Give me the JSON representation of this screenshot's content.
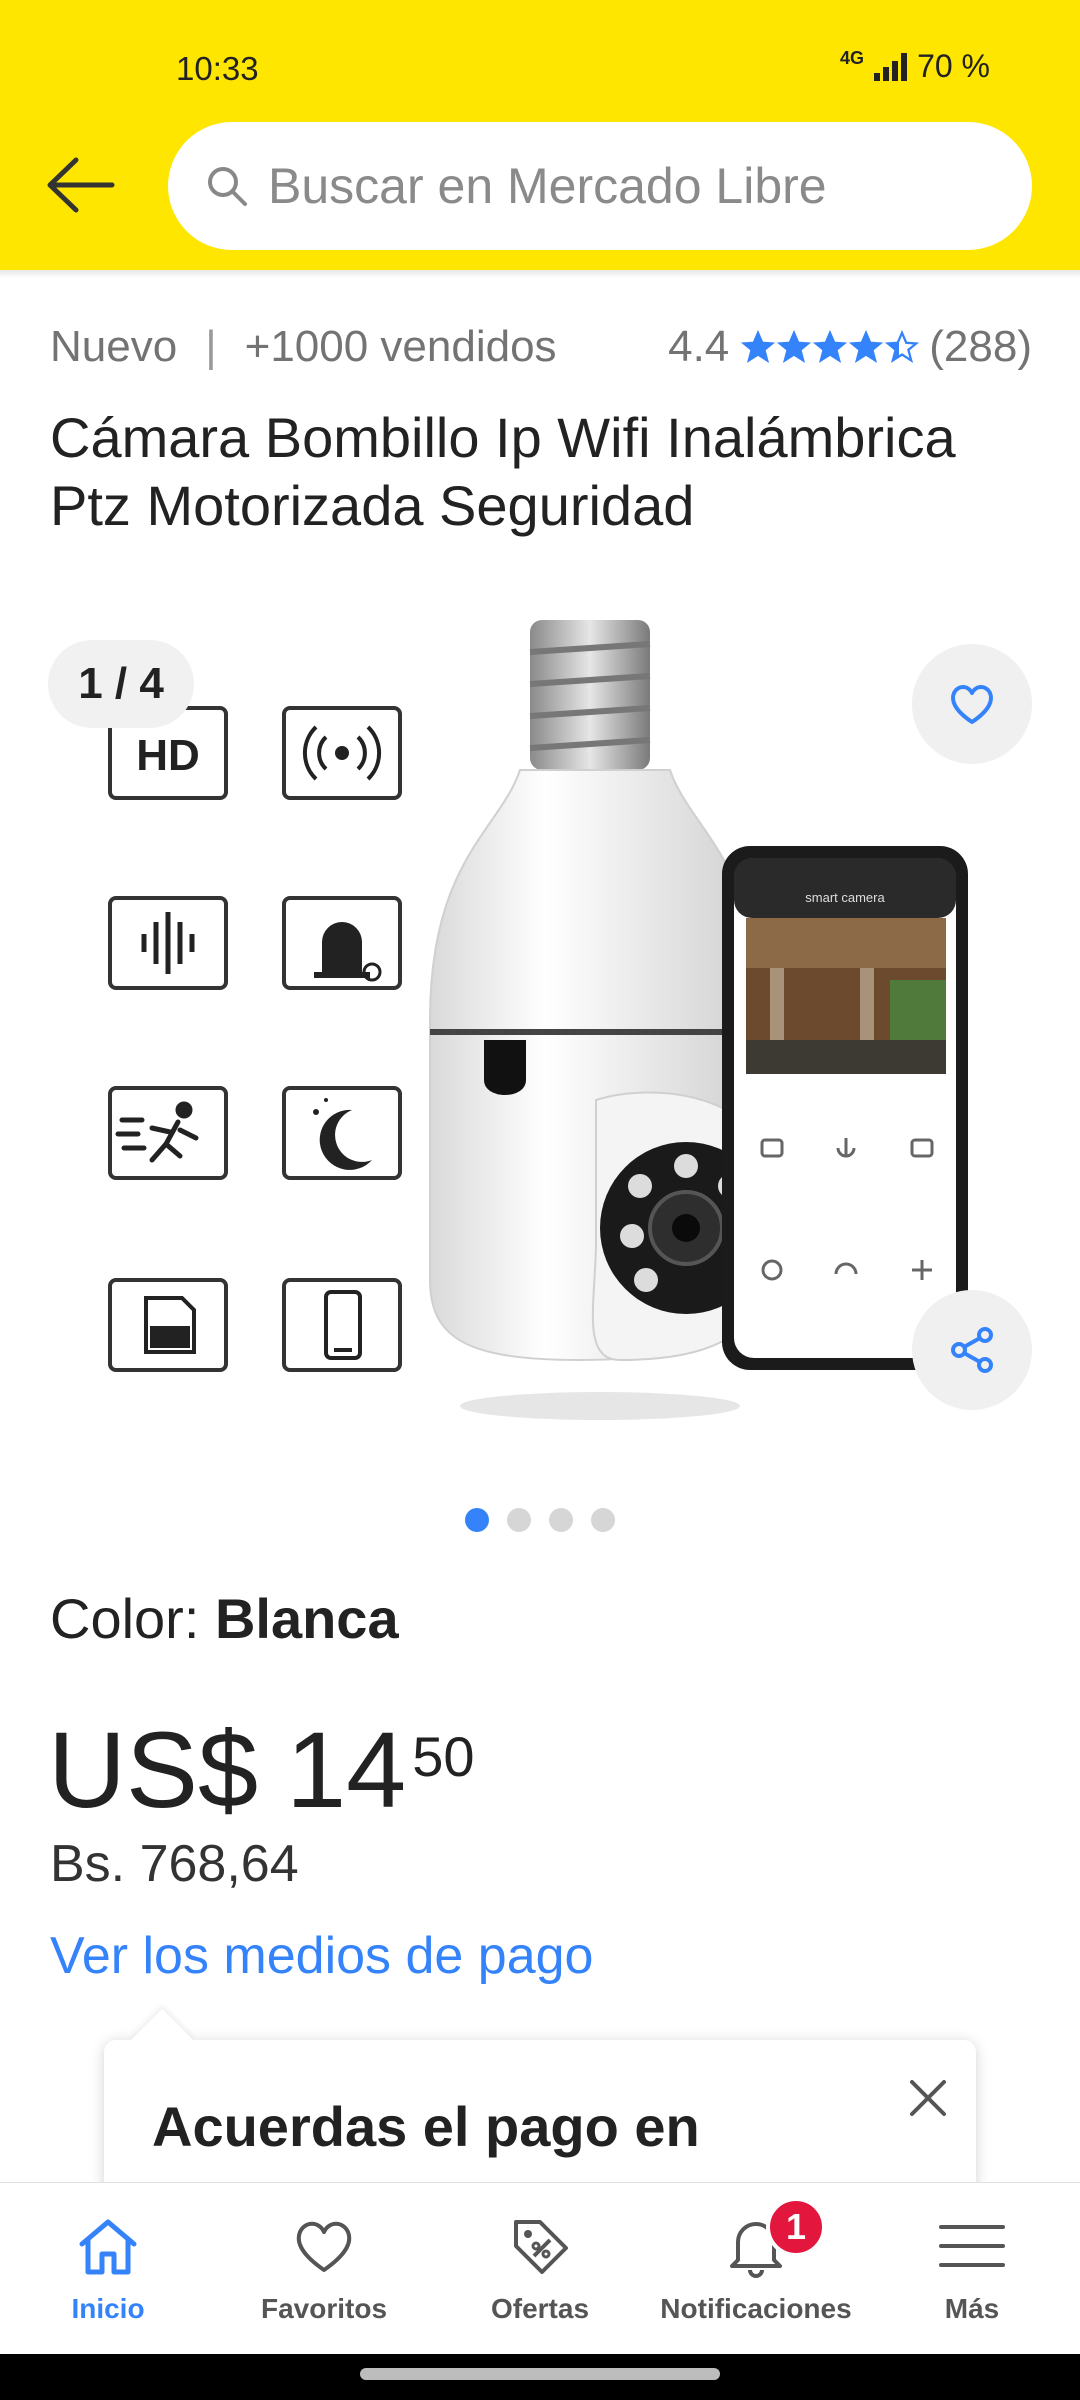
{
  "status": {
    "time": "10:33",
    "network": "4G",
    "battery": "70 %"
  },
  "header": {
    "search_placeholder": "Buscar en Mercado Libre"
  },
  "product": {
    "condition": "Nuevo",
    "separator": "|",
    "sold": "+1000 vendidos",
    "rating": "4.4",
    "rating_stars": 4.4,
    "reviews": "(288)",
    "title": "Cámara Bombillo Ip Wifi Inalámbrica Ptz Motorizada Seguridad"
  },
  "gallery": {
    "counter": "1 / 4",
    "total_images": 4,
    "active_index": 0,
    "phone_screen_title": "smart camera",
    "feature_icons": [
      "hd-icon",
      "wireless-icon",
      "audio-icon",
      "alarm-icon",
      "motion-icon",
      "night-icon",
      "sd-card-icon",
      "phone-icon"
    ]
  },
  "variant": {
    "label": "Color:",
    "value": "Blanca"
  },
  "price": {
    "currency": "US$",
    "amount": "14",
    "cents": "50",
    "local": "Bs. 768,64",
    "payment_link": "Ver los medios de pago"
  },
  "tooltip": {
    "text": "Acuerdas el pago en"
  },
  "nav": {
    "items": [
      {
        "label": "Inicio",
        "icon": "home-icon",
        "active": true
      },
      {
        "label": "Favoritos",
        "icon": "heart-icon"
      },
      {
        "label": "Ofertas",
        "icon": "tag-icon"
      },
      {
        "label": "Notificaciones",
        "icon": "bell-icon",
        "badge": "1"
      },
      {
        "label": "Más",
        "icon": "menu-icon"
      }
    ]
  },
  "colors": {
    "brand_yellow": "#ffe600",
    "accent_blue": "#3483fa",
    "badge_red": "#e3173e"
  }
}
